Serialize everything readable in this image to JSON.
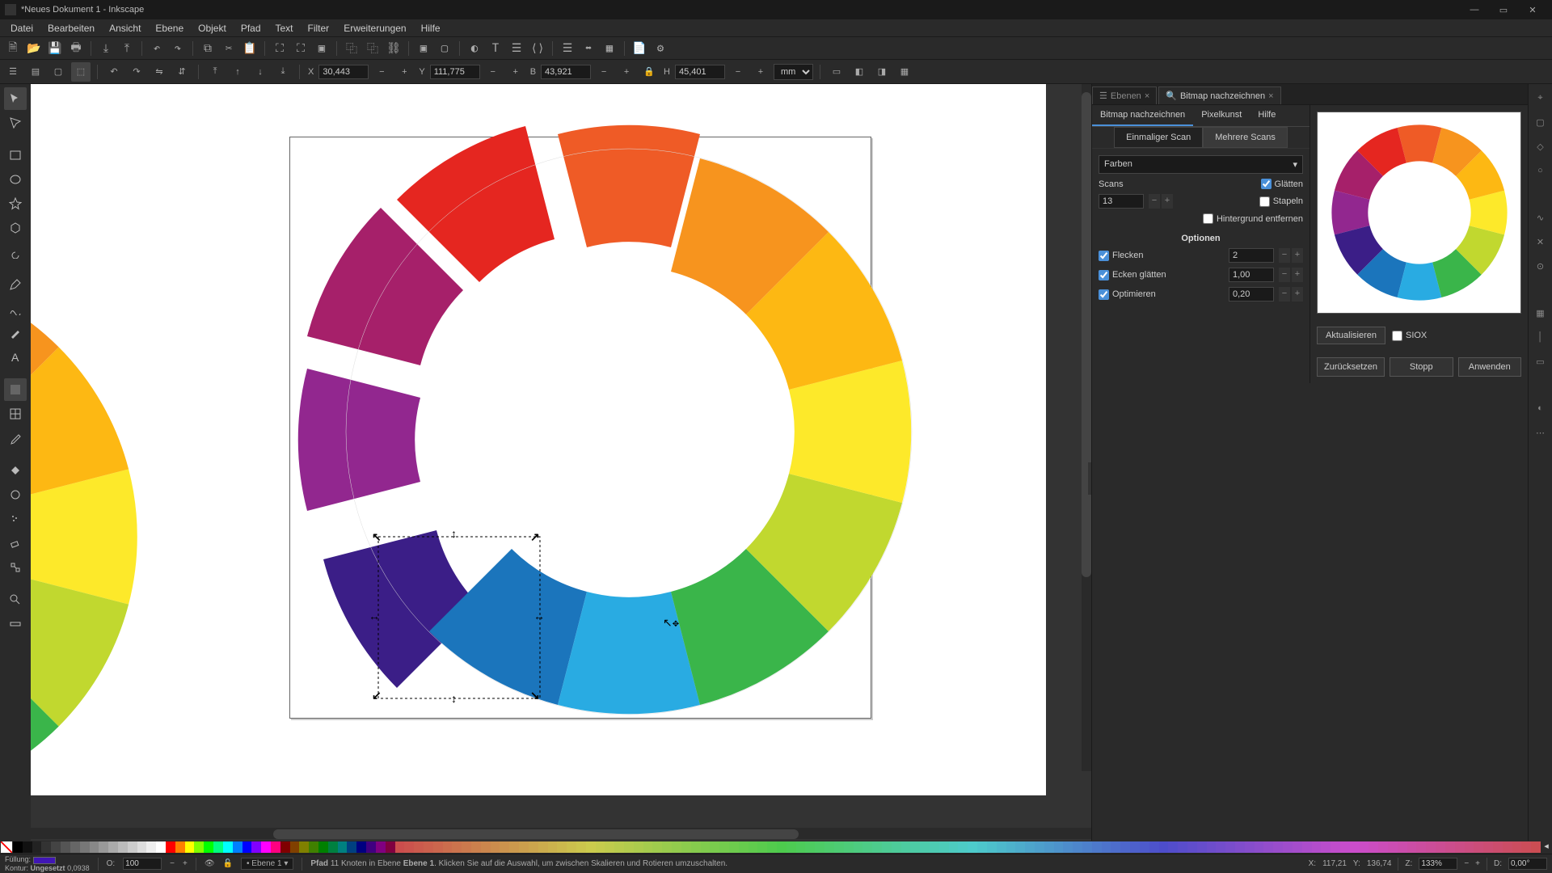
{
  "window": {
    "title": "*Neues Dokument 1 - Inkscape"
  },
  "menu": [
    "Datei",
    "Bearbeiten",
    "Ansicht",
    "Ebene",
    "Objekt",
    "Pfad",
    "Text",
    "Filter",
    "Erweiterungen",
    "Hilfe"
  ],
  "toolcontrol": {
    "x_label": "X",
    "x": "30,443",
    "y_label": "Y",
    "y": "111,775",
    "w_label": "B",
    "w": "43,921",
    "h_label": "H",
    "h": "45,401",
    "unit": "mm"
  },
  "panels": {
    "tab_layers": "Ebenen",
    "tab_trace": "Bitmap nachzeichnen",
    "subtab_trace": "Bitmap nachzeichnen",
    "subtab_pixel": "Pixelkunst",
    "subtab_help": "Hilfe",
    "scan_single": "Einmaliger Scan",
    "scan_multi": "Mehrere Scans",
    "mode": "Farben",
    "scans_label": "Scans",
    "scans_value": "13",
    "smooth": "Glätten",
    "stack": "Stapeln",
    "removebg": "Hintergrund entfernen",
    "options": "Optionen",
    "speckles": "Flecken",
    "speckles_val": "2",
    "corners": "Ecken glätten",
    "corners_val": "1,00",
    "optimize": "Optimieren",
    "optimize_val": "0,20",
    "update": "Aktualisieren",
    "siox": "SIOX",
    "reset": "Zurücksetzen",
    "stop": "Stopp",
    "apply": "Anwenden"
  },
  "status": {
    "fill_label": "Füllung:",
    "stroke_label": "Kontur:",
    "stroke_val": "Ungesetzt",
    "stroke_w": "0,0938",
    "opacity_label": "O:",
    "opacity": "100",
    "layer": "Ebene 1",
    "hint_prefix": "Pfad",
    "hint_count": "11 Knoten in Ebene",
    "hint_layer": "Ebene 1",
    "hint_rest": ". Klicken Sie auf die Auswahl, um zwischen Skalieren und Rotieren umzuschalten.",
    "cx_label": "X:",
    "cx": "117,21",
    "cy_label": "Y:",
    "cy": "136,74",
    "zoom_label": "Z:",
    "zoom": "133%",
    "rot_label": "D:",
    "rot": "0,00°"
  },
  "chart_data": [
    {
      "type": "pie",
      "title": "",
      "note": "Donut-style color wheel (main canvas, exploded segments)",
      "series": [
        {
          "name": "wheel",
          "values": [
            1,
            1,
            1,
            1,
            1,
            1,
            1,
            1,
            1,
            1,
            1,
            1
          ]
        }
      ],
      "categories": [
        "red",
        "red-orange",
        "orange",
        "yellow-orange",
        "yellow",
        "yellow-green",
        "green",
        "cyan",
        "blue",
        "indigo",
        "violet",
        "magenta"
      ],
      "colors": [
        "#e52620",
        "#ef5b26",
        "#f7941e",
        "#fdb813",
        "#fde92a",
        "#c1d82f",
        "#3ab54a",
        "#29abe2",
        "#1b75bc",
        "#3b1e87",
        "#92278f",
        "#a6206a"
      ]
    },
    {
      "type": "pie",
      "title": "",
      "note": "Donut-style color wheel (preview thumbnail)",
      "series": [
        {
          "name": "wheel",
          "values": [
            1,
            1,
            1,
            1,
            1,
            1,
            1,
            1,
            1,
            1,
            1,
            1
          ]
        }
      ],
      "categories": [
        "red",
        "red-orange",
        "orange",
        "yellow-orange",
        "yellow",
        "yellow-green",
        "green",
        "cyan",
        "blue",
        "indigo",
        "violet",
        "magenta"
      ],
      "colors": [
        "#e52620",
        "#ef5b26",
        "#f7941e",
        "#fdb813",
        "#fde92a",
        "#c1d82f",
        "#3ab54a",
        "#29abe2",
        "#1b75bc",
        "#3b1e87",
        "#92278f",
        "#a6206a"
      ]
    }
  ]
}
